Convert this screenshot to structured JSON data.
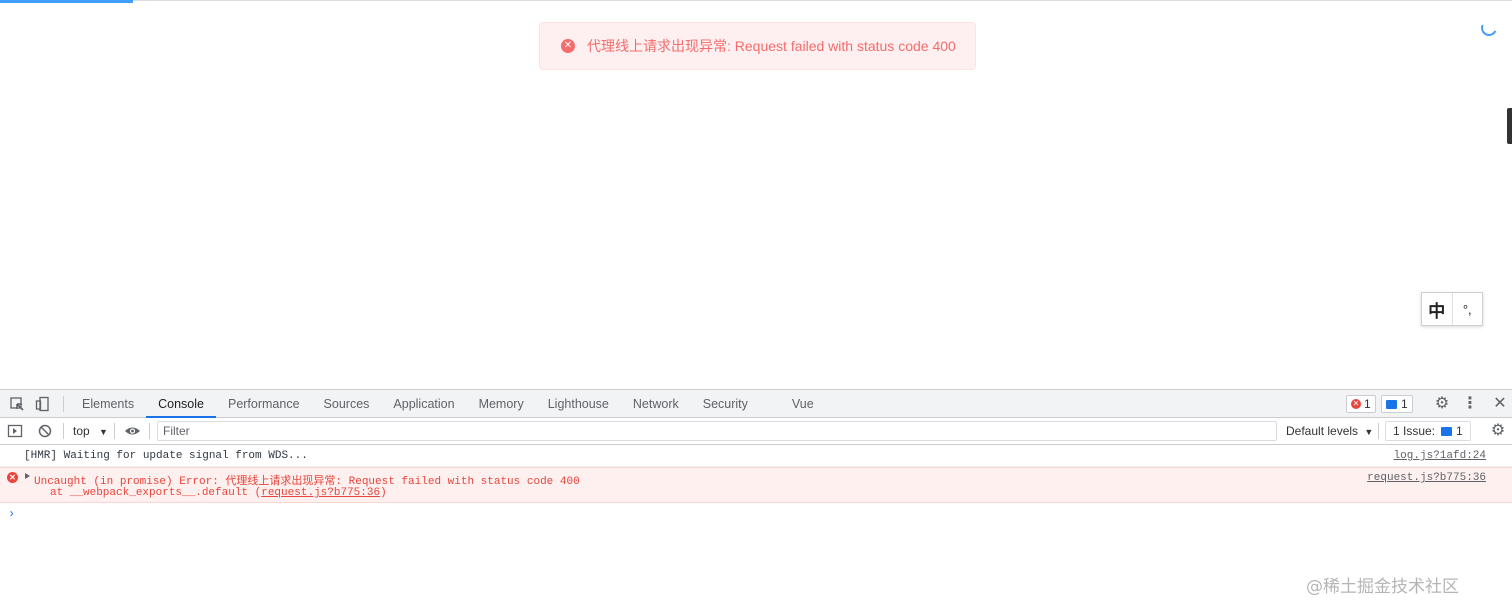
{
  "page": {
    "toast_message": "代理线上请求出现异常: Request failed with status code 400",
    "ime": {
      "mode_label": "中",
      "settings_glyph": "°,"
    }
  },
  "devtools": {
    "tabs": [
      "Elements",
      "Console",
      "Performance",
      "Sources",
      "Application",
      "Memory",
      "Lighthouse",
      "Network",
      "Security",
      "Vue"
    ],
    "active_tab": "Console",
    "error_count": "1",
    "message_count": "1",
    "console_toolbar": {
      "context": "top",
      "filter_placeholder": "Filter",
      "levels_label": "Default levels",
      "issues_label": "1 Issue:",
      "issues_count": "1"
    },
    "logs": [
      {
        "text": "[HMR] Waiting for update signal from WDS...",
        "source": "log.js?1afd:24",
        "level": "info"
      },
      {
        "text": "Uncaught (in promise) Error: 代理线上请求出现异常: Request failed with status code 400",
        "stack_prefix": "at __webpack_exports__.default (",
        "stack_link": "request.js?b775:36",
        "stack_suffix": ")",
        "source": "request.js?b775:36",
        "level": "error"
      }
    ],
    "prompt": "›"
  },
  "watermark": "@稀土掘金技术社区",
  "colors": {
    "error": "#f56c6c",
    "accent": "#1a73e8",
    "console_error": "#e8453c"
  }
}
